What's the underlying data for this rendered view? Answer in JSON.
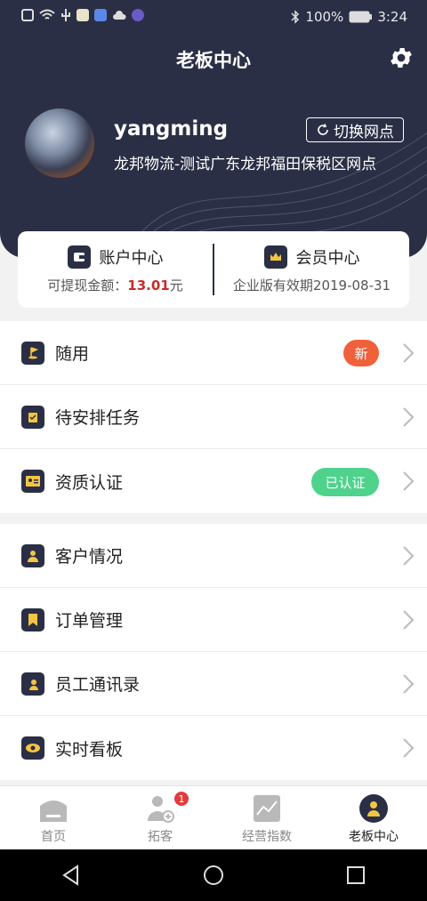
{
  "status_bar": {
    "battery": "100%",
    "time": "3:24"
  },
  "header": {
    "title": "老板中心"
  },
  "profile": {
    "username": "yangming",
    "switch_label": "切换网点",
    "branch": "龙邦物流-测试广东龙邦福田保税区网点"
  },
  "cards": {
    "account": {
      "label": "账户中心",
      "balance_label": "可提现金额：",
      "balance_value": "13.01",
      "balance_unit": "元"
    },
    "member": {
      "label": "会员中心",
      "validity": "企业版有效期2019-08-31"
    }
  },
  "menu_group1": [
    {
      "label": "随用",
      "badge": "新"
    },
    {
      "label": "待安排任务"
    },
    {
      "label": "资质认证",
      "badge": "已认证"
    }
  ],
  "menu_group2": [
    {
      "label": "客户情况"
    },
    {
      "label": "订单管理"
    },
    {
      "label": "员工通讯录"
    },
    {
      "label": "实时看板"
    }
  ],
  "tabbar": [
    {
      "label": "首页"
    },
    {
      "label": "拓客",
      "badge": "1"
    },
    {
      "label": "经营指数"
    },
    {
      "label": "老板中心",
      "active": true
    }
  ],
  "colors": {
    "header_bg": "#2b2f45",
    "new_badge": "#f0603a",
    "verified_badge": "#4ed28c",
    "amount": "#c72b2b"
  }
}
